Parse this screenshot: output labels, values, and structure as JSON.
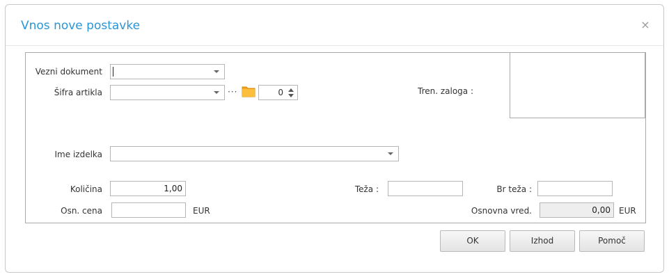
{
  "dialog": {
    "title": "Vnos nove postavke",
    "close_glyph": "×"
  },
  "fields": {
    "vezni_dokument_label": "Vezni dokument",
    "sifra_artikla_label": "Šifra artikla",
    "sifra_dots": "···",
    "sifra_spin_value": "0",
    "tren_zaloga_label": "Tren. zaloga :",
    "ime_izdelka_label": "Ime izdelka",
    "kolicina_label": "Količina",
    "kolicina_value": "1,00",
    "osn_cena_label": "Osn. cena",
    "osn_cena_currency": "EUR",
    "teza_label": "Teža :",
    "br_teza_label": "Br teža :",
    "osnovna_vred_label": "Osnovna vred.",
    "osnovna_vred_value": "0,00",
    "osnovna_vred_currency": "EUR"
  },
  "buttons": {
    "ok": "OK",
    "izhod": "Izhod",
    "pomoc": "Pomoč"
  },
  "colors": {
    "title": "#2b95d6",
    "folder": "#f5a623"
  },
  "icons": {
    "close": "close-icon",
    "dropdown": "chevron-down-icon",
    "browse": "folder-icon",
    "spinner": "spinner-arrows-icon"
  }
}
